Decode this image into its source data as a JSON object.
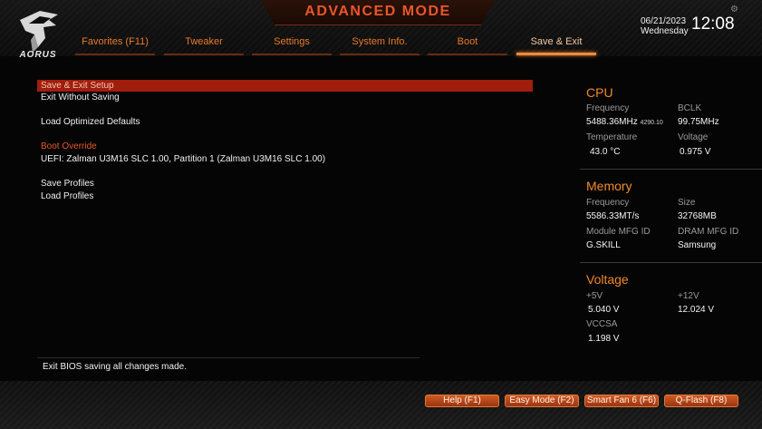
{
  "header": {
    "mode_title": "ADVANCED MODE",
    "brand": "AORUS",
    "date": "06/21/2023",
    "weekday": "Wednesday",
    "time": "12:08",
    "tabs": [
      {
        "label": "Favorites (F11)",
        "active": false
      },
      {
        "label": "Tweaker",
        "active": false
      },
      {
        "label": "Settings",
        "active": false
      },
      {
        "label": "System Info.",
        "active": false
      },
      {
        "label": "Boot",
        "active": false
      },
      {
        "label": "Save & Exit",
        "active": true
      }
    ]
  },
  "menu": {
    "items": [
      {
        "label": "Save & Exit Setup",
        "state": "selected"
      },
      {
        "label": "Exit Without Saving",
        "state": "normal"
      },
      {
        "label": "Load Optimized Defaults",
        "state": "normal"
      },
      {
        "label": "Boot Override",
        "state": "section"
      },
      {
        "label": "UEFI: Zalman U3M16 SLC 1.00, Partition 1 (Zalman U3M16 SLC 1.00)",
        "state": "normal"
      },
      {
        "label": "Save Profiles",
        "state": "normal"
      },
      {
        "label": "Load Profiles",
        "state": "normal"
      }
    ]
  },
  "help_text": "Exit BIOS saving all changes made.",
  "panel": {
    "cpu": {
      "title": "CPU",
      "frequency_label": "Frequency",
      "frequency_value": "5488.36MHz",
      "frequency_sub": "4290.10",
      "bclk_label": "BCLK",
      "bclk_value": "99.75MHz",
      "temperature_label": "Temperature",
      "temperature_value": "43.0 °C",
      "voltage_label": "Voltage",
      "voltage_value": "0.975 V"
    },
    "memory": {
      "title": "Memory",
      "frequency_label": "Frequency",
      "frequency_value": "5586.33MT/s",
      "size_label": "Size",
      "size_value": "32768MB",
      "module_mfg_label": "Module MFG ID",
      "module_mfg_value": "G.SKILL",
      "dram_mfg_label": "DRAM MFG ID",
      "dram_mfg_value": "Samsung"
    },
    "voltage": {
      "title": "Voltage",
      "p5v_label": "+5V",
      "p5v_value": "5.040 V",
      "p12v_label": "+12V",
      "p12v_value": "12.024 V",
      "vccsa_label": "VCCSA",
      "vccsa_value": "1.198 V"
    }
  },
  "footer": {
    "buttons": [
      {
        "label": "Help (F1)"
      },
      {
        "label": "Easy Mode (F2)"
      },
      {
        "label": "Smart Fan 6 (F6)"
      },
      {
        "label": "Q-Flash (F8)"
      }
    ]
  },
  "colors": {
    "accent_orange": "#e8562a",
    "selected_bar": "#a11d0c",
    "section_title": "#f08a2a"
  }
}
